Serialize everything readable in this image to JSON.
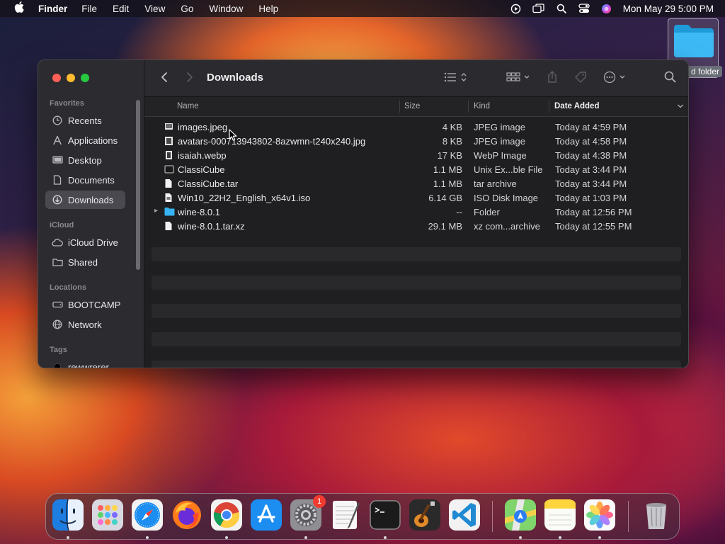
{
  "menubar": {
    "apple_icon": "apple-logo",
    "app_name": "Finder",
    "menus": [
      "File",
      "Edit",
      "View",
      "Go",
      "Window",
      "Help"
    ],
    "status_icons": [
      "screen-recording-icon",
      "screen-mirroring-icon",
      "spotlight-icon",
      "control-center-icon",
      "siri-icon"
    ],
    "clock": "Mon May 29  5:00 PM"
  },
  "desktop": {
    "folder_label": "d folder"
  },
  "window": {
    "title": "Downloads",
    "sidebar": {
      "favorites_label": "Favorites",
      "favorites": [
        {
          "label": "Recents",
          "icon": "clock-icon"
        },
        {
          "label": "Applications",
          "icon": "applications-icon"
        },
        {
          "label": "Desktop",
          "icon": "desktop-icon"
        },
        {
          "label": "Documents",
          "icon": "document-icon"
        },
        {
          "label": "Downloads",
          "icon": "download-icon",
          "selected": true
        }
      ],
      "icloud_label": "iCloud",
      "icloud": [
        {
          "label": "iCloud Drive",
          "icon": "cloud-icon"
        },
        {
          "label": "Shared",
          "icon": "shared-folder-icon"
        }
      ],
      "locations_label": "Locations",
      "locations": [
        {
          "label": "BOOTCAMP",
          "icon": "disk-icon"
        },
        {
          "label": "Network",
          "icon": "network-icon"
        }
      ],
      "tags_label": "Tags",
      "tags": [
        {
          "label": "rewwrerer",
          "color": "#000000"
        }
      ]
    },
    "columns": {
      "name": "Name",
      "size": "Size",
      "kind": "Kind",
      "date_added": "Date Added"
    },
    "files": [
      {
        "name": "images.jpeg",
        "size": "4 KB",
        "kind": "JPEG image",
        "date": "Today at 4:59 PM",
        "icon": "image-file-icon"
      },
      {
        "name": "avatars-000713943802-8azwmn-t240x240.jpg",
        "size": "8 KB",
        "kind": "JPEG image",
        "date": "Today at 4:58 PM",
        "icon": "image-file-icon"
      },
      {
        "name": "isaiah.webp",
        "size": "17 KB",
        "kind": "WebP Image",
        "date": "Today at 4:38 PM",
        "icon": "image-file-icon"
      },
      {
        "name": "ClassiCube",
        "size": "1.1 MB",
        "kind": "Unix Ex...ble File",
        "date": "Today at 3:44 PM",
        "icon": "executable-icon"
      },
      {
        "name": "ClassiCube.tar",
        "size": "1.1 MB",
        "kind": "tar archive",
        "date": "Today at 3:44 PM",
        "icon": "document-icon"
      },
      {
        "name": "Win10_22H2_English_x64v1.iso",
        "size": "6.14 GB",
        "kind": "ISO Disk Image",
        "date": "Today at 1:03 PM",
        "icon": "disk-image-icon"
      },
      {
        "name": "wine-8.0.1",
        "size": "--",
        "kind": "Folder",
        "date": "Today at 12:56 PM",
        "icon": "folder-icon",
        "folder": true
      },
      {
        "name": "wine-8.0.1.tar.xz",
        "size": "29.1 MB",
        "kind": "xz com...archive",
        "date": "Today at 12:55 PM",
        "icon": "document-icon"
      }
    ]
  },
  "dock": {
    "apps": [
      {
        "name": "finder-app",
        "running": true
      },
      {
        "name": "launchpad-app",
        "running": false
      },
      {
        "name": "safari-app",
        "running": true
      },
      {
        "name": "firefox-app",
        "running": false
      },
      {
        "name": "chrome-app",
        "running": true
      },
      {
        "name": "app-store-app",
        "running": false
      },
      {
        "name": "system-settings-app",
        "running": true,
        "badge": "1"
      },
      {
        "name": "textedit-app",
        "running": false
      },
      {
        "name": "terminal-app",
        "running": true
      },
      {
        "name": "garageband-app",
        "running": false
      },
      {
        "name": "vscode-app",
        "running": false
      },
      {
        "name": "maps-app",
        "running": true
      },
      {
        "name": "notes-app",
        "running": true
      },
      {
        "name": "photos-app",
        "running": true
      },
      {
        "name": "trash-app",
        "running": false
      }
    ]
  }
}
